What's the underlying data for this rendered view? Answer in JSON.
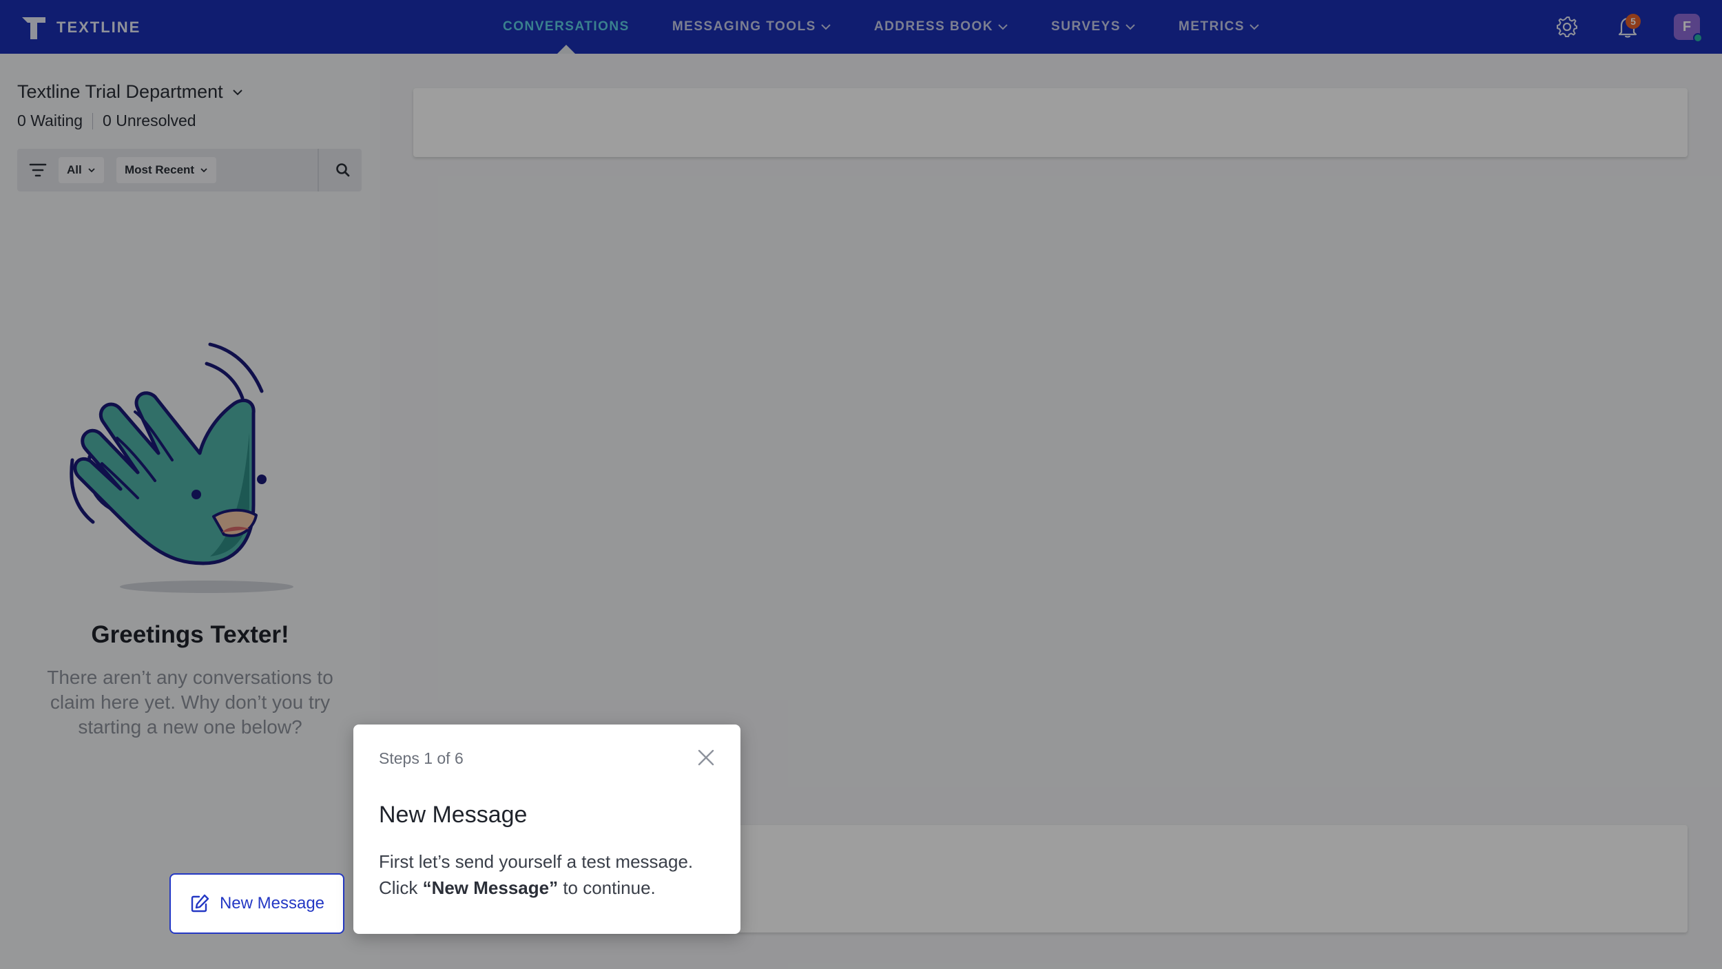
{
  "app": {
    "brand_name": "TEXTLINE",
    "accent_color": "#1a2fb5",
    "active_nav_color": "#5ed1e6"
  },
  "nav": {
    "items": [
      {
        "label": "CONVERSATIONS",
        "active": true,
        "dropdown": false
      },
      {
        "label": "MESSAGING TOOLS",
        "active": false,
        "dropdown": true
      },
      {
        "label": "ADDRESS BOOK",
        "active": false,
        "dropdown": true
      },
      {
        "label": "SURVEYS",
        "active": false,
        "dropdown": true
      },
      {
        "label": "METRICS",
        "active": false,
        "dropdown": true
      }
    ]
  },
  "topbar": {
    "notification_count": "5",
    "avatar_initial": "F",
    "icons": [
      "gear-icon",
      "bell-icon",
      "avatar"
    ]
  },
  "sidebar": {
    "department": "Textline Trial Department",
    "waiting_count": "0",
    "waiting_label": "Waiting",
    "unresolved_count": "0",
    "unresolved_label": "Unresolved",
    "filter_all": "All",
    "sort_label": "Most Recent",
    "greeting_title": "Greetings Texter!",
    "greeting_body": "There aren’t any conversations to claim here yet. Why don’t you try starting a new one below?",
    "new_message_label": "New Message"
  },
  "tour": {
    "step": "Steps 1 of 6",
    "title": "New Message",
    "body_line1": "First let’s send yourself a test message.",
    "body_click": "Click ",
    "body_bold": "“New Message”",
    "body_end": " to continue."
  }
}
